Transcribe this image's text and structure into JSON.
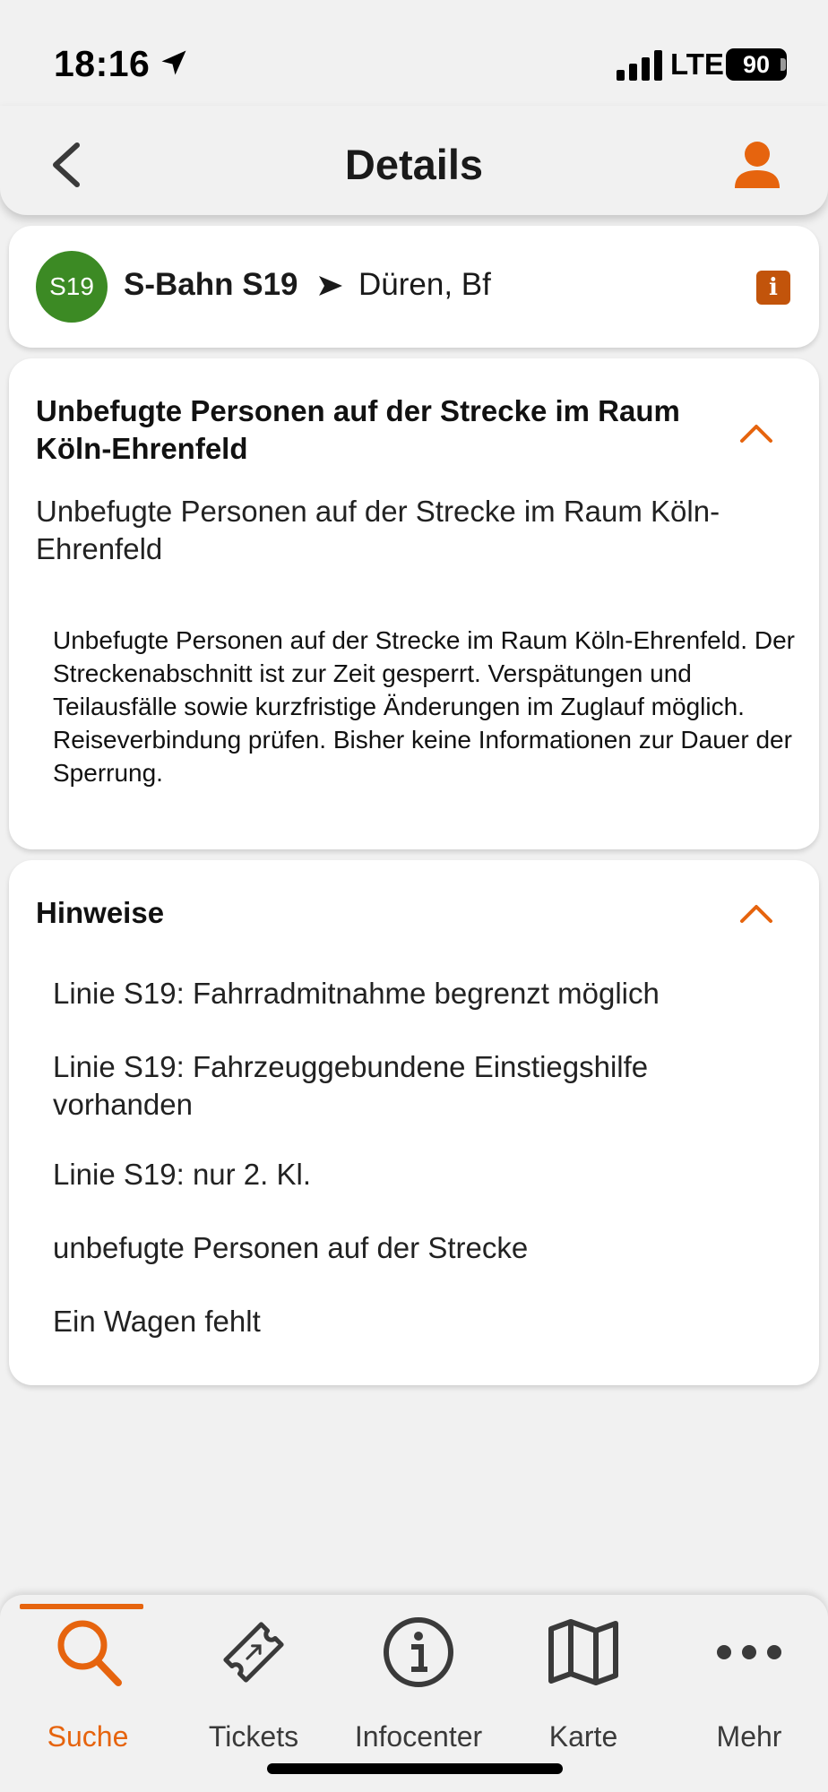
{
  "status_bar": {
    "time": "18:16",
    "network": "LTE",
    "battery": "90"
  },
  "header": {
    "title": "Details"
  },
  "line": {
    "badge": "S19",
    "badge_color": "#3c8a24",
    "name": "S-Bahn S19",
    "destination": "Düren, Bf",
    "info_icon": "i"
  },
  "disruption": {
    "title": "Unbefugte Personen auf der Strecke im Raum Köln-Ehrenfeld",
    "summary": "Unbefugte Personen auf der Strecke im Raum Köln-Ehrenfeld",
    "body": "Unbefugte Personen auf der Strecke im Raum Köln-Ehrenfeld. Der Streckenabschnitt ist zur Zeit gesperrt. Verspätungen und Teilausfälle sowie kurzfristige Änderungen im Zuglauf möglich. Reiseverbindung prüfen. Bisher keine Informationen zur Dauer der Sperrung."
  },
  "hints": {
    "title": "Hinweise",
    "items": [
      "Linie S19: Fahrradmitnahme begrenzt möglich",
      "Linie S19: Fahrzeuggebundene Einstiegshilfe vorhanden",
      "Linie S19: nur 2. Kl.",
      "unbefugte Personen auf der Strecke",
      "Ein Wagen fehlt"
    ]
  },
  "tabs": [
    {
      "label": "Suche",
      "icon": "search-icon",
      "active": true
    },
    {
      "label": "Tickets",
      "icon": "ticket-icon",
      "active": false
    },
    {
      "label": "Infocenter",
      "icon": "info-icon",
      "active": false
    },
    {
      "label": "Karte",
      "icon": "map-icon",
      "active": false
    },
    {
      "label": "Mehr",
      "icon": "more-icon",
      "active": false
    }
  ],
  "colors": {
    "accent": "#e6640e",
    "info_badge": "#c2540b",
    "background": "#f1f1f1"
  }
}
